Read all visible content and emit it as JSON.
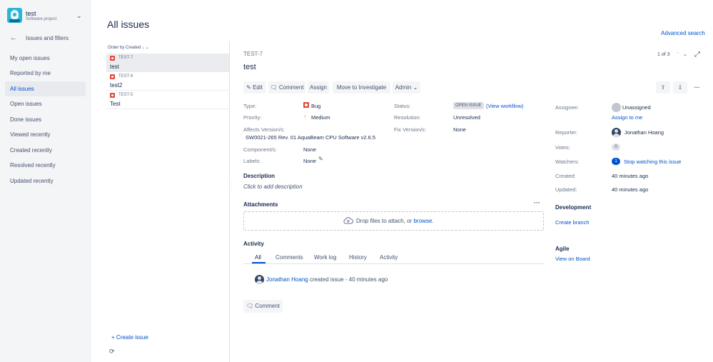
{
  "project": {
    "name": "test",
    "type": "Software project"
  },
  "sidebar": {
    "back_label": "Issues and filters",
    "items": [
      {
        "label": "My open issues"
      },
      {
        "label": "Reported by me"
      },
      {
        "label": "All issues"
      },
      {
        "label": "Open issues"
      },
      {
        "label": "Done issues"
      },
      {
        "label": "Viewed recently"
      },
      {
        "label": "Created recently"
      },
      {
        "label": "Resolved recently"
      },
      {
        "label": "Updated recently"
      }
    ]
  },
  "page": {
    "title": "All issues",
    "advanced_search": "Advanced search"
  },
  "list": {
    "order_label": "Order by Created",
    "issues": [
      {
        "key": "TEST-7",
        "summary": "test"
      },
      {
        "key": "TEST-6",
        "summary": "test2"
      },
      {
        "key": "TEST-5",
        "summary": "Test"
      }
    ],
    "create_label": "+ Create issue"
  },
  "detail": {
    "key": "TEST-7",
    "title": "test",
    "pager": "1 of 3",
    "toolbar": {
      "edit": "Edit",
      "comment": "Comment",
      "assign": "Assign",
      "move": "Move to Investigate",
      "admin": "Admin"
    },
    "fields": {
      "type_label": "Type:",
      "type_value": "Bug",
      "priority_label": "Priority:",
      "priority_value": "Medium",
      "affects_label": "Affects Version/s:",
      "affects_value": "SW0021-265 Rev. 01 AquaBeam CPU Software v2.6.5",
      "component_label": "Component/s:",
      "component_value": "None",
      "labels_label": "Labels:",
      "labels_value": "None",
      "status_label": "Status:",
      "status_value": "OPEN ISSUE",
      "view_workflow": "(View workflow)",
      "resolution_label": "Resolution:",
      "resolution_value": "Unresolved",
      "fix_label": "Fix Version/s:",
      "fix_value": "None"
    },
    "description": {
      "heading": "Description",
      "placeholder": "Click to add description"
    },
    "attachments": {
      "heading": "Attachments",
      "drop_text": "Drop files to attach, or ",
      "browse": "browse."
    },
    "activity": {
      "heading": "Activity",
      "tabs": [
        "All",
        "Comments",
        "Work log",
        "History",
        "Activity"
      ],
      "entry_user": "Jonathan Hoang",
      "entry_text": "created issue - 40 minutes ago",
      "comment_button": "Comment"
    },
    "people": {
      "assignee_label": "Assignee:",
      "assignee_value": "Unassigned",
      "assign_to_me": "Assign to me",
      "reporter_label": "Reporter:",
      "reporter_value": "Jonathan Hoang",
      "votes_label": "Votes:",
      "votes_value": "0",
      "watchers_label": "Watchers:",
      "watchers_value": "1",
      "watch_action": "Stop watching this issue",
      "created_label": "Created:",
      "created_value": "40 minutes ago",
      "updated_label": "Updated:",
      "updated_value": "40 minutes ago"
    },
    "development": {
      "heading": "Development",
      "link": "Create branch"
    },
    "agile": {
      "heading": "Agile",
      "link": "View on Board"
    }
  },
  "colors": {
    "accent": "#0052cc",
    "bug": "#e5493a",
    "priority_medium": "#f79232"
  }
}
